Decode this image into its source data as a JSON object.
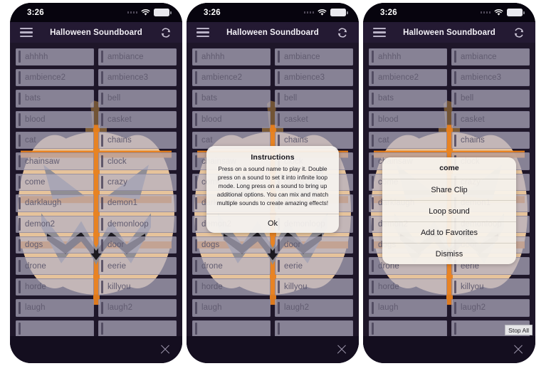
{
  "app": {
    "title": "Halloween Soundboard",
    "menu_icon": "hamburger-menu-icon",
    "refresh_icon": "refresh-icon"
  },
  "status_bar": {
    "time": "3:26",
    "signal_icon": "signal-dots-icon",
    "wifi_icon": "wifi-icon",
    "battery_icon": "battery-icon"
  },
  "sounds": [
    "ahhhh",
    "ambiance",
    "ambience2",
    "ambience3",
    "bats",
    "bell",
    "blood",
    "casket",
    "cat",
    "chains",
    "chainsaw",
    "clock",
    "come",
    "crazy",
    "darklaugh",
    "demon1",
    "demon2",
    "demonloop",
    "dogs",
    "door",
    "drone",
    "eerie",
    "horde",
    "killyou",
    "laugh",
    "laugh2",
    "",
    ""
  ],
  "bottom_bar": {
    "stop_all_label": "Stop All",
    "close_icon": "close-x-icon"
  },
  "instructions_dialog": {
    "title": "Instructions",
    "message": "Press on a sound name to play it. Double press on a sound to set it into infinite loop mode. Long press on a sound to bring up additional options. You can mix and match multiple sounds to create amazing effects!",
    "ok_label": "Ok"
  },
  "action_sheet": {
    "title": "come",
    "items": [
      "Share Clip",
      "Loop sound",
      "Add to Favorites",
      "Dismiss"
    ]
  },
  "colors": {
    "screen_bg": "#1e1629",
    "navbar_bg": "#241a33",
    "statusbar_bg": "#07040e",
    "cell_bg": "#b4b0c3",
    "cell_text": "#615c70",
    "pumpkin_body": "#f7d2a5",
    "pumpkin_ridge": "#e8801d",
    "pumpkin_face": "#8b8b93",
    "pumpkin_stem": "#8f6a3a",
    "dialog_bg": "#f6f3ef"
  },
  "panels": [
    {
      "name": "panel-base"
    },
    {
      "name": "panel-instructions"
    },
    {
      "name": "panel-action-sheet"
    }
  ]
}
